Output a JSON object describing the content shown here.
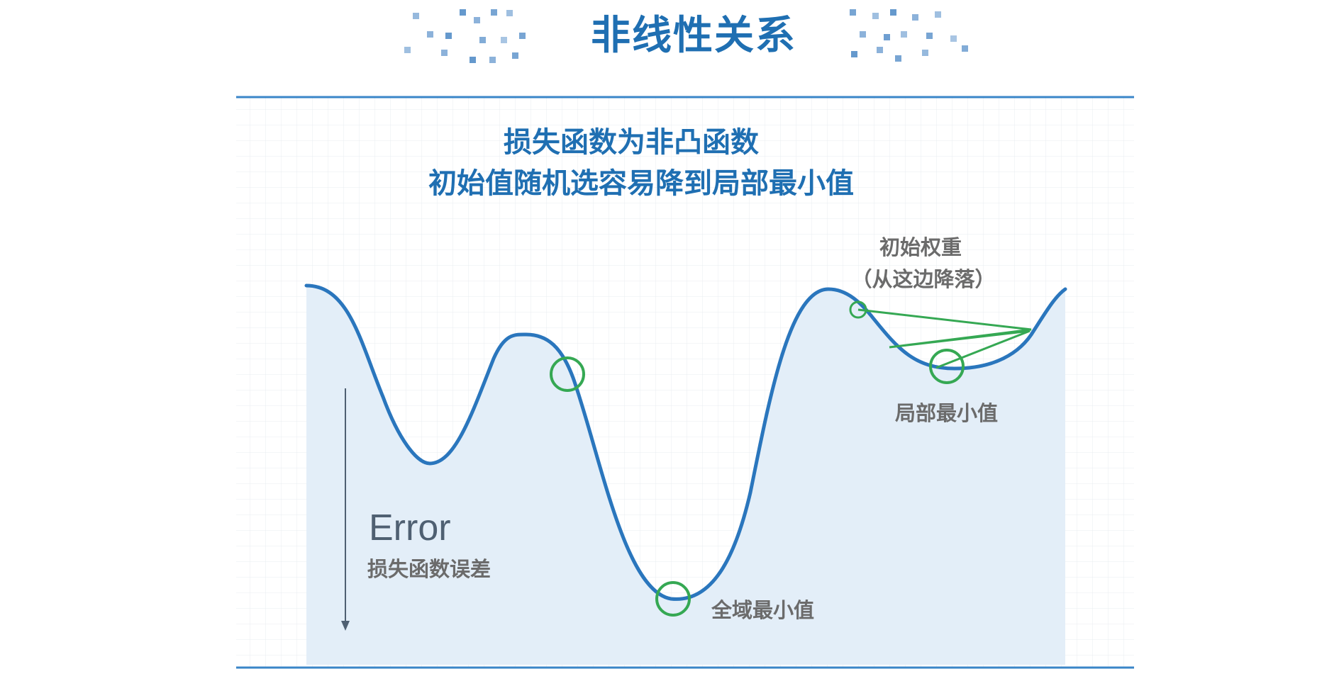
{
  "title": "非线性关系",
  "subtitle_lines": [
    "损失函数为非凸函数",
    "初始值随机选容易降到局部最小值"
  ],
  "axis": {
    "word": "Error",
    "caption": "损失函数误差"
  },
  "annotations": {
    "initial_weight_line1": "初始权重",
    "initial_weight_line2": "（从这边降落）",
    "local_min": "局部最小值",
    "global_min": "全域最小值"
  },
  "colors": {
    "accent": "#1f6fb2",
    "curve": "#2a76bd",
    "fill": "#e3eef8",
    "marker": "#35a853",
    "label": "#6b6b6b",
    "arrow": "#4f6072",
    "grid": "#e8ecf1"
  }
}
